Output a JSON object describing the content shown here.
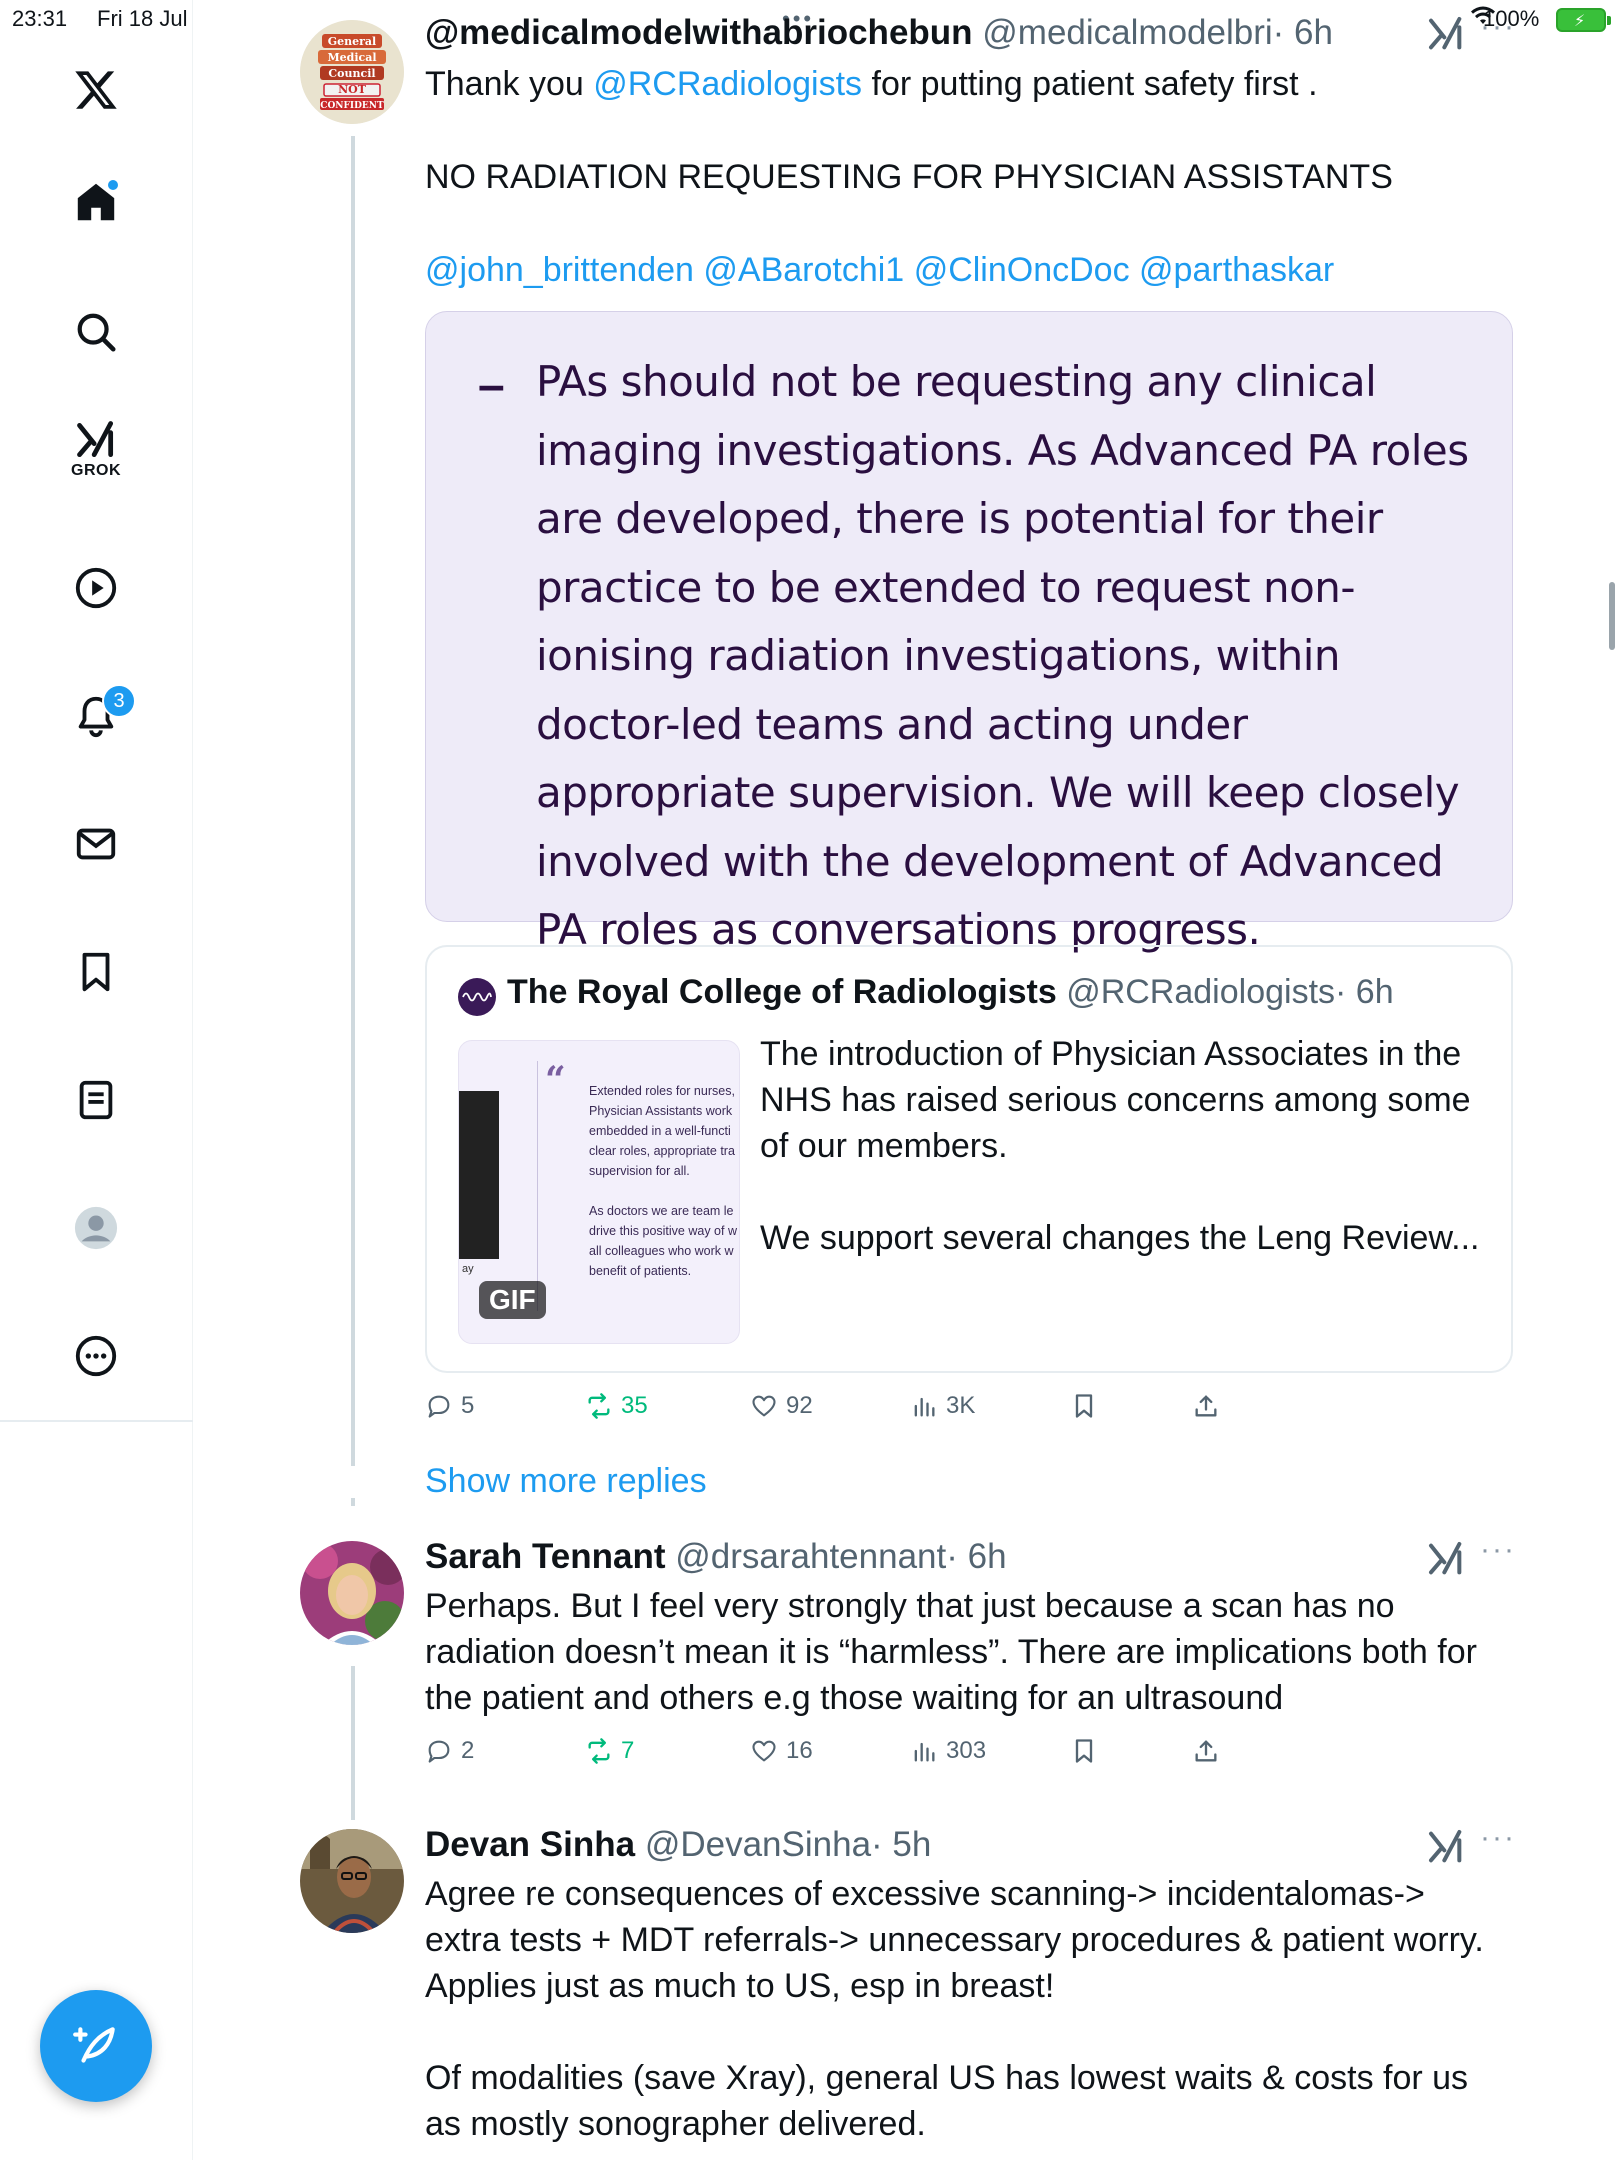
{
  "status_bar": {
    "time": "23:31",
    "date": "Fri 18 Jul",
    "battery": "100%"
  },
  "sidebar": {
    "grok_label": "GROK",
    "notifications_badge": "3"
  },
  "tweets": [
    {
      "name": "@medicalmodelwithabriochebun",
      "handle": "@medicalmodelbri",
      "time": "· 6h",
      "avatar_text": [
        "General",
        "Medical",
        "Council",
        "NOT",
        "CONFIDENT"
      ],
      "text_line1_pre": "Thank you ",
      "text_line1_mention": "@RCRadiologists",
      "text_line1_post": " for putting patient safety first .",
      "text_line2": "NO RADIATION REQUESTING FOR PHYSICIAN ASSISTANTS",
      "mentions": [
        "@john_brittenden",
        "@ABarotchi1",
        "@ClinOncDoc",
        "@parthaskar"
      ],
      "image_text": "PAs should not be requesting any clinical imaging investigations. As Advanced PA roles are developed, there is potential for their practice to be extended to request non-ionising radiation investigations, within doctor-led teams and acting under appropriate supervision. We will keep closely involved with the development of Advanced PA roles as conversations progress.",
      "image_dash": "–",
      "quoted": {
        "name": "The Royal College of Radiologists",
        "handle": "@RCRadiologists",
        "time": "· 6h",
        "text_p1": "The introduction of Physician Associates in the NHS has raised serious concerns among some of our members.",
        "text_p2": "We support several changes the Leng Review...",
        "thumb_lines": [
          "Extended roles for nurses,",
          "Physician Assistants work",
          "embedded in a well-functi",
          "clear roles, appropriate tra",
          "supervision for all.",
          "",
          "As doctors we are team le",
          "drive this positive way of w",
          "all colleagues who work w",
          "benefit of patients."
        ],
        "thumb_ay": "ay",
        "gif_label": "GIF"
      },
      "actions": {
        "replies": "5",
        "reposts": "35",
        "likes": "92",
        "views": "3K"
      }
    },
    {
      "name": "Sarah Tennant",
      "handle": "@drsarahtennant",
      "time": "· 6h",
      "text": "Perhaps. But I feel very strongly that just because a scan has no radiation doesn’t mean it is “harmless”.  There are implications both for the patient and others e.g those waiting for an ultrasound",
      "actions": {
        "replies": "2",
        "reposts": "7",
        "likes": "16",
        "views": "303"
      }
    },
    {
      "name": "Devan Sinha",
      "handle": "@DevanSinha",
      "time": "· 5h",
      "text_p1": "Agree re consequences of excessive scanning-> incidentalomas-> extra tests + MDT referrals-> unnecessary procedures & patient worry. Applies just as much to US, esp in breast!",
      "text_p2": "Of modalities (save Xray), general US has lowest waits  & costs for us as mostly sonographer delivered."
    }
  ],
  "show_more_replies": "Show more replies",
  "colors": {
    "accent": "#1d9bf0",
    "repost_green": "#00ba7c",
    "image_bg": "#eeebf8",
    "image_text": "#2a0f40"
  }
}
